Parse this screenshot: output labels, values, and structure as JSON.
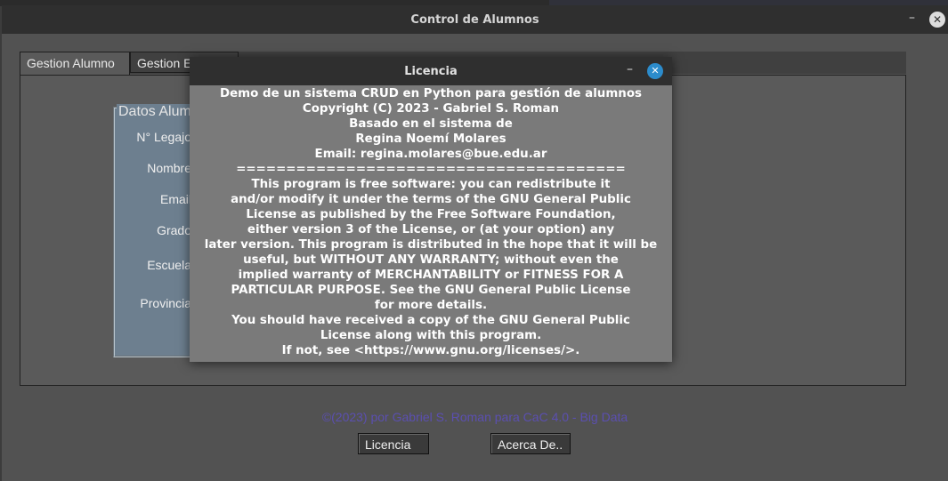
{
  "main_window": {
    "title": "Control de Alumnos",
    "minimize_glyph": "–",
    "close_glyph": "✕"
  },
  "tabs": [
    {
      "label": "Gestion Alumno",
      "active": true
    },
    {
      "label": "Gestion E"
    }
  ],
  "datos_alumno": {
    "legend": "Datos Alum",
    "fields": [
      "N° Legajo",
      "Nombre",
      "Email",
      "Grado",
      "Escuela",
      "Provincia"
    ]
  },
  "footer": {
    "credit": "©(2023) por Gabriel S. Roman para CaC 4.0 - Big Data",
    "licencia_button": "Licencia",
    "acerca_button": "Acerca De.."
  },
  "dialog": {
    "title": "Licencia",
    "minimize_glyph": "–",
    "close_glyph": "✕",
    "lines": [
      "Demo de un sistema CRUD en Python para gestión de alumnos",
      "Copyright (C) 2023 - Gabriel S. Roman",
      "Basado en el sistema de",
      "Regina Noemí Molares",
      "Email: regina.molares@bue.edu.ar",
      "=======================================",
      "This program is free software: you can redistribute it",
      "and/or modify it under the terms of the GNU General Public",
      "License as published by the Free Software Foundation,",
      "either version 3 of the License, or (at your option) any",
      "later version. This program is distributed in the hope that it will be",
      "useful, but WITHOUT ANY WARRANTY; without even the",
      "implied warranty of MERCHANTABILITY or FITNESS FOR A",
      "PARTICULAR PURPOSE. See the GNU General Public License",
      "for more details.",
      "You should have received a copy of the GNU General Public",
      "License along with this program.",
      "If not, see <https://www.gnu.org/licenses/>."
    ]
  },
  "colors": {
    "footer_text": "#5b4fb0",
    "dialog_close": "#2c8ccc",
    "frame_bg": "#6d7f8f"
  }
}
